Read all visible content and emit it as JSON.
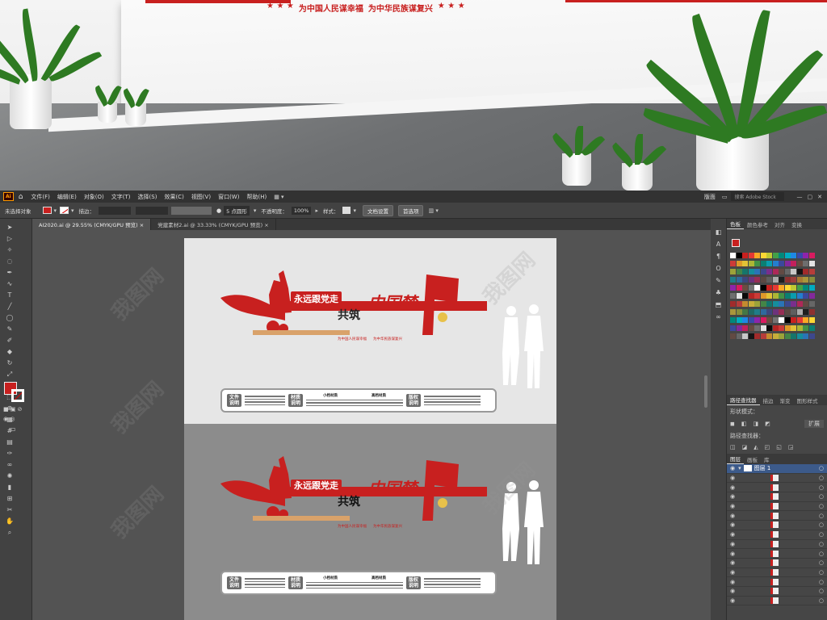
{
  "scene": {
    "slogan_1": "为中国人民谋幸福",
    "slogan_2": "为中华民族谋复兴",
    "stars": "★ ★ ★"
  },
  "app": {
    "logo": "Ai",
    "menu": [
      "文件(F)",
      "编辑(E)",
      "对象(O)",
      "文字(T)",
      "选择(S)",
      "效果(C)",
      "视图(V)",
      "窗口(W)",
      "帮助(H)"
    ],
    "workspace": "版面",
    "search_placeholder": "搜索 Adobe Stock"
  },
  "control_bar": {
    "selection_status": "未选择对象",
    "stroke_label": "描边：",
    "brush_label": "5 点圆形",
    "opacity_label": "不透明度：",
    "opacity_value": "100%",
    "style_label": "样式：",
    "doc_setup_button": "文档设置",
    "prefs_button": "首选项"
  },
  "tabs": [
    {
      "label": "AI2020.ai @ 29.55% (CMYK/GPU 预览)",
      "active": true
    },
    {
      "label": "党建素材2.ai @ 33.33% (CMYK/GPU 预览)",
      "active": false
    }
  ],
  "design": {
    "banner_line": "永远跟党走",
    "main_word": "共筑",
    "dream": "中国梦",
    "bottom_slogan_1": "为中国人民谋幸福",
    "bottom_slogan_2": "为中华民族谋复兴",
    "info_labels": [
      "文件说明",
      "材质说明",
      "版权说明"
    ],
    "info_heading_1": "小档材质",
    "info_heading_2": "高档材质"
  },
  "right_strip": {
    "icons": [
      "paint-icon",
      "type-icon",
      "paragraph-icon",
      "opentype-icon",
      "brush-icon",
      "symbol-icon",
      "export-icon",
      "link-icon"
    ]
  },
  "panels": {
    "swatches_tabs": [
      "色板",
      "颜色参考",
      "对齐",
      "变换"
    ],
    "pathfinder_tabs": [
      "路径查找器",
      "描边",
      "渐变",
      "图形样式"
    ],
    "shape_modes_label": "形状模式：",
    "expand_button": "扩展",
    "pathfinders_label": "路径查找器：",
    "layer_tabs": [
      "图层",
      "画板",
      "库"
    ],
    "layer_name": "图层 1"
  },
  "colors": {
    "accent_red": "#c8201f",
    "ui_dark": "#323232",
    "ui_mid": "#424242",
    "canvas": "#535353"
  },
  "watermark": "我图网"
}
